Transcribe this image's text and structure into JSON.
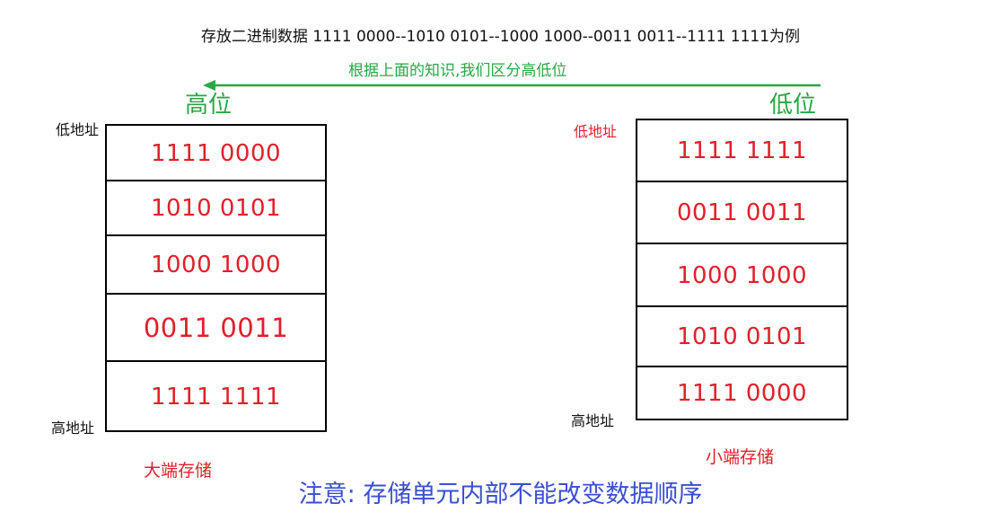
{
  "title": "存放二进制数据 1111 0000--1010 0101--1000 1000--0011 0011--1111 1111为例",
  "arrow_note": "根据上面的知识,我们区分高低位",
  "high_label": "高位",
  "low_label": "低位",
  "colors": {
    "green": "#28a745",
    "red": "#e0202a",
    "blue": "#3a4fcf"
  },
  "big_endian": {
    "low_address_label": "低地址",
    "high_address_label": "高地址",
    "cells": [
      "1111 0000",
      "1010 0101",
      "1000 1000",
      "0011 0011",
      "1111 1111"
    ],
    "caption": "大端存储"
  },
  "little_endian": {
    "low_address_label": "低地址",
    "high_address_label": "高地址",
    "cells": [
      "1111 1111",
      "0011 0011",
      "1000 1000",
      "1010 0101",
      "1111 0000"
    ],
    "caption": "小端存储"
  },
  "note": "注意: 存储单元内部不能改变数据顺序"
}
